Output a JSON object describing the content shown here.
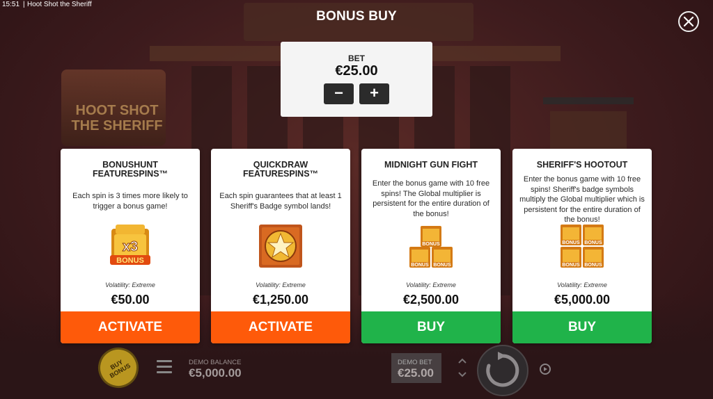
{
  "status_bar": {
    "time": "15:51",
    "separator": "|",
    "app_title": "Hoot Shot the Sheriff"
  },
  "background": {
    "logo_text": "HOOT SHOT THE SHERIFF"
  },
  "header": {
    "title": "BONUS BUY",
    "close_icon": "close-icon"
  },
  "bet": {
    "label": "BET",
    "value": "€25.00",
    "minus_label": "−",
    "plus_label": "+"
  },
  "cards": [
    {
      "title_line1": "BONUSHUNT",
      "title_line2": "FEATURESPINS™",
      "description": "Each spin is 3 times more likely to trigger a bonus game!",
      "icon": "x3-bonus-icon",
      "icon_text_top": "x3",
      "icon_text_bottom": "BONUS",
      "volatility": "Volatility: Extreme",
      "price": "€50.00",
      "action": "ACTIVATE",
      "action_color": "#fe5a0a"
    },
    {
      "title_line1": "QUICKDRAW",
      "title_line2": "FEATURESPINS™",
      "description": "Each spin guarantees that at least 1 Sheriff's Badge symbol lands!",
      "icon": "sheriff-badge-icon",
      "volatility": "Volatility: Extreme",
      "price": "€1,250.00",
      "action": "ACTIVATE",
      "action_color": "#fe5a0a"
    },
    {
      "title_line1": "MIDNIGHT GUN FIGHT",
      "title_line2": "",
      "description": "Enter the bonus game with 10 free spins! The Global multiplier is persistent for the entire duration of the bonus!",
      "icon": "three-bonus-chests-icon",
      "icon_text": "BONUS",
      "volatility": "Volatility: Extreme",
      "price": "€2,500.00",
      "action": "BUY",
      "action_color": "#20b34a"
    },
    {
      "title_line1": "SHERIFF'S HOOTOUT",
      "title_line2": "",
      "description": "Enter the bonus game with 10 free spins! Sheriff's badge symbols multiply the Global multiplier which is persistent for the entire duration of the bonus!",
      "icon": "four-bonus-chests-icon",
      "icon_text": "BONUS",
      "volatility": "Volatility: Extreme",
      "price": "€5,000.00",
      "action": "BUY",
      "action_color": "#20b34a"
    }
  ],
  "bottom_bar": {
    "buy_bonus_line1": "BUY",
    "buy_bonus_line2": "BONUS",
    "menu_icon": "hamburger-menu-icon",
    "balance_label": "DEMO BALANCE",
    "balance_value": "€5,000.00",
    "bet_label": "DEMO BET",
    "bet_value": "€25.00",
    "bet_up_icon": "chevron-up-icon",
    "bet_down_icon": "chevron-down-icon",
    "spin_icon": "spin-arrows-icon",
    "autoplay_icon": "autoplay-icon"
  }
}
